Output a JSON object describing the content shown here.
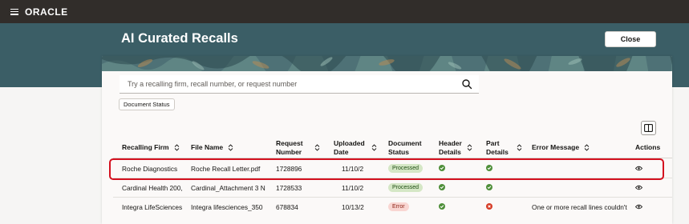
{
  "app": {
    "brand": "ORACLE",
    "menu_icon": "hamburger-menu-icon"
  },
  "header": {
    "title": "AI Curated Recalls",
    "close_label": "Close"
  },
  "search": {
    "placeholder": "Try a recalling firm, recall number, or request number",
    "icon": "search-icon"
  },
  "filters": {
    "document_status_label": "Document Status"
  },
  "toolbar": {
    "columns_icon": "columns-icon"
  },
  "table": {
    "headers": {
      "recalling_firm": "Recalling Firm",
      "file_name": "File Name",
      "request_number_1": "Request",
      "request_number_2": "Number",
      "uploaded_date_1": "Uploaded",
      "uploaded_date_2": "Date",
      "document_status_1": "Document",
      "document_status_2": "Status",
      "header_details_1": "Header",
      "header_details_2": "Details",
      "part_details_1": "Part",
      "part_details_2": "Details",
      "error_message": "Error Message",
      "actions": "Actions"
    },
    "rows": [
      {
        "recalling_firm": "Roche Diagnostics",
        "file_name": "Roche Recall Letter.pdf",
        "request_number": "1728896",
        "uploaded_date": "11/10/2",
        "document_status": "Processed",
        "status_kind": "success",
        "header_details": "check-icon",
        "part_details": "check-icon",
        "error_message": "",
        "action_icon": "view-icon",
        "highlighted": true
      },
      {
        "recalling_firm": "Cardinal Health 200,",
        "file_name": "Cardinal_Attachment 3 N",
        "request_number": "1728533",
        "uploaded_date": "11/10/2",
        "document_status": "Processed",
        "status_kind": "success",
        "header_details": "check-icon",
        "part_details": "check-icon",
        "error_message": "",
        "action_icon": "view-icon",
        "highlighted": false
      },
      {
        "recalling_firm": "Integra LifeSciences",
        "file_name": "Integra lifesciences_350",
        "request_number": "678834",
        "uploaded_date": "10/13/2",
        "document_status": "Error",
        "status_kind": "error",
        "header_details": "check-icon",
        "part_details": "error-icon",
        "error_message": "One or more recall lines couldn't",
        "action_icon": "view-icon",
        "highlighted": false
      }
    ]
  },
  "colors": {
    "topbar": "#312d2a",
    "banner": "#3b5e66",
    "success_badge": "#d5e7c6",
    "error_badge": "#f9d6d2",
    "check_green": "#4f8f3a",
    "error_red": "#d63b25",
    "highlight_border": "#d4111f"
  }
}
